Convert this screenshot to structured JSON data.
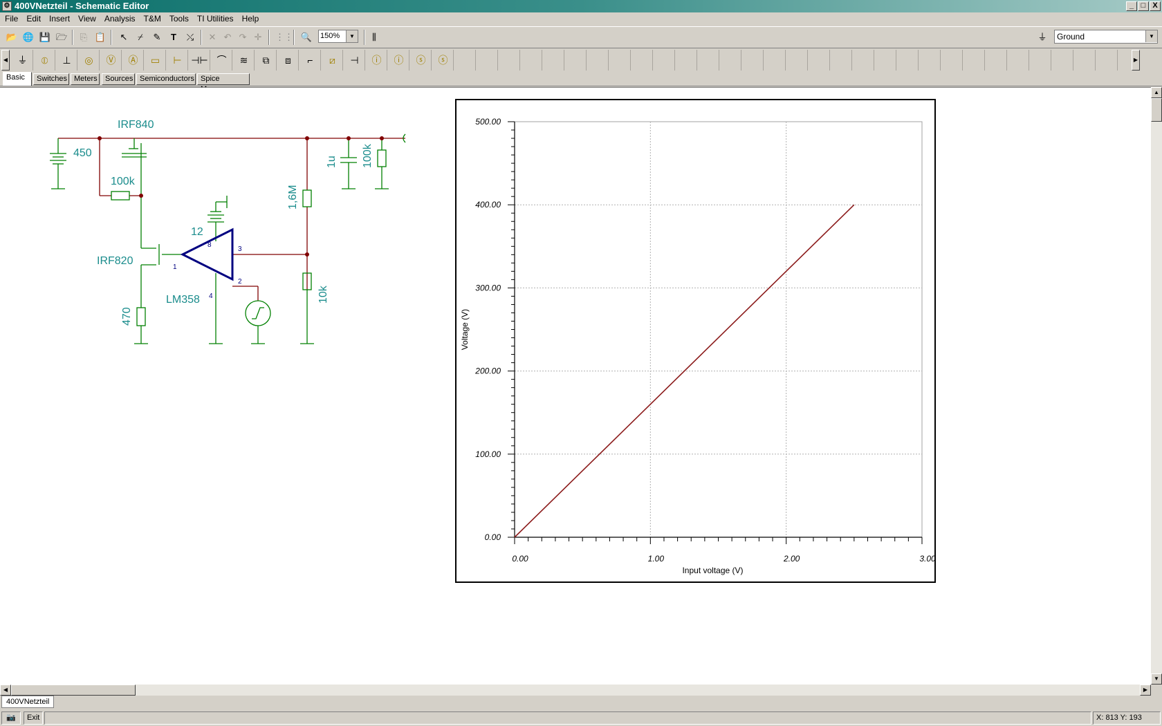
{
  "window": {
    "title": "400VNetzteil - Schematic Editor",
    "controls": [
      "_",
      "□",
      "X"
    ]
  },
  "menu": [
    "File",
    "Edit",
    "Insert",
    "View",
    "Analysis",
    "T&M",
    "Tools",
    "TI Utilities",
    "Help"
  ],
  "toolbar": {
    "zoom_value": "150%",
    "ground_value": "Ground"
  },
  "component_tabs": [
    "Basic",
    "Switches",
    "Meters",
    "Sources",
    "Semiconductors",
    "Spice Macros"
  ],
  "active_tab": "Basic",
  "schematic": {
    "labels": {
      "mosfet_top": "IRF840",
      "mosfet_low": "IRF820",
      "opamp": "LM358",
      "battery_main": "450",
      "battery_op": "12",
      "r_gate": "100k",
      "r_470": "470",
      "r_1m6": "1,6M",
      "r_10k": "10k",
      "c_1u": "1u",
      "r_load": "100k",
      "pin1": "1",
      "pin2": "2",
      "pin3": "3",
      "pin4": "4",
      "pin8": "8"
    }
  },
  "chart_data": {
    "type": "line",
    "title": "",
    "xlabel": "Input voltage (V)",
    "ylabel": "Voltage (V)",
    "xlim": [
      0,
      3
    ],
    "ylim": [
      0,
      500
    ],
    "xticks": [
      "0.00",
      "1.00",
      "2.00",
      "3.00"
    ],
    "yticks": [
      "0.00",
      "100.00",
      "200.00",
      "300.00",
      "400.00",
      "500.00"
    ],
    "grid": true,
    "series": [
      {
        "color": "#8b1a1a",
        "x": [
          0,
          0.5,
          1.0,
          1.5,
          2.0,
          2.5
        ],
        "y": [
          0,
          80,
          160,
          240,
          320,
          400
        ]
      }
    ]
  },
  "document_tab": "400VNetzteil",
  "status": {
    "exit_label": "Exit",
    "coords": "X: 813  Y: 193"
  },
  "colors": {
    "title_gradient_start": "#0a6f6a",
    "schematic_wire": "#800000",
    "schematic_component": "#008000",
    "schematic_label": "#1a8c8c",
    "opamp": "#000080",
    "plot_line": "#8b1a1a"
  }
}
